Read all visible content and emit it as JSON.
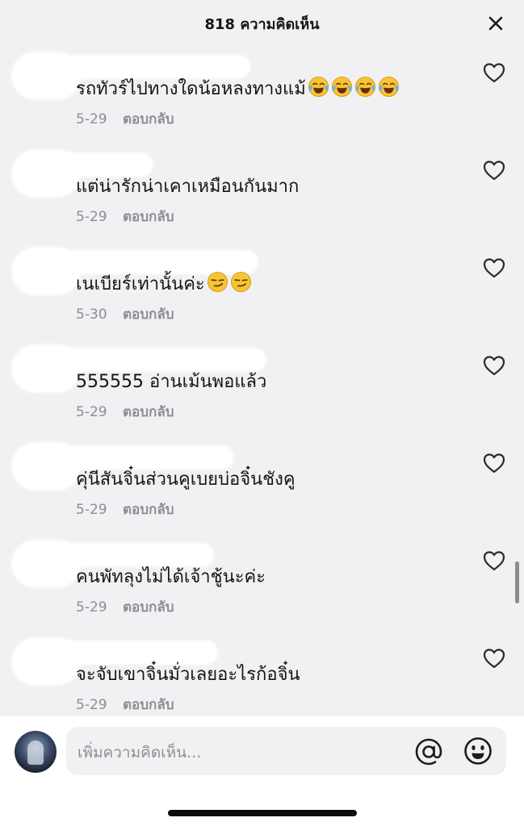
{
  "header": {
    "title": "818 ความคิดเห็น"
  },
  "comments": [
    {
      "text": "รถทัวร์ไปทางใดน้อหลงทางแม้",
      "emojis": [
        "face-with-tears-of-joy-icon",
        "face-with-tears-of-joy-icon",
        "face-with-tears-of-joy-icon",
        "face-with-tears-of-joy-icon"
      ],
      "date": "5-29",
      "reply": "ตอบกลับ"
    },
    {
      "text": "แต่น่ารักน่าเคาเหมือนกันมาก",
      "emojis": [],
      "date": "5-29",
      "reply": "ตอบกลับ"
    },
    {
      "text": "เนเบียร์เท่านั้นค่ะ",
      "emojis": [
        "smirking-face-icon",
        "smirking-face-icon"
      ],
      "date": "5-30",
      "reply": "ตอบกลับ"
    },
    {
      "text": "555555 อ่านเม้นพอแล้ว",
      "emojis": [],
      "date": "5-29",
      "reply": "ตอบกลับ"
    },
    {
      "text": "คุ่นีสันจิ๋นส่วนคูเบยบ่อจิ๋นชังคู",
      "emojis": [],
      "date": "5-29",
      "reply": "ตอบกลับ"
    },
    {
      "text": "คนพัทลุงไม่ได้เจ้าชู้นะค่ะ",
      "emojis": [],
      "date": "5-29",
      "reply": "ตอบกลับ"
    },
    {
      "text": "จะจับเขาจิ๋นมั่วเลยอะไรก้อจิ๋น",
      "emojis": [],
      "date": "5-29",
      "reply": "ตอบกลับ"
    }
  ],
  "composer": {
    "placeholder": "เพิ่มความคิดเห็น..."
  },
  "icons": {
    "close": "close-icon",
    "like": "heart-outline-icon",
    "mention": "at-sign-icon",
    "emoji": "smiley-face-icon"
  },
  "colors": {
    "background": "#f1f1f4",
    "text": "#151515",
    "meta": "#8d8d93",
    "icon": "#2b2b2b"
  }
}
